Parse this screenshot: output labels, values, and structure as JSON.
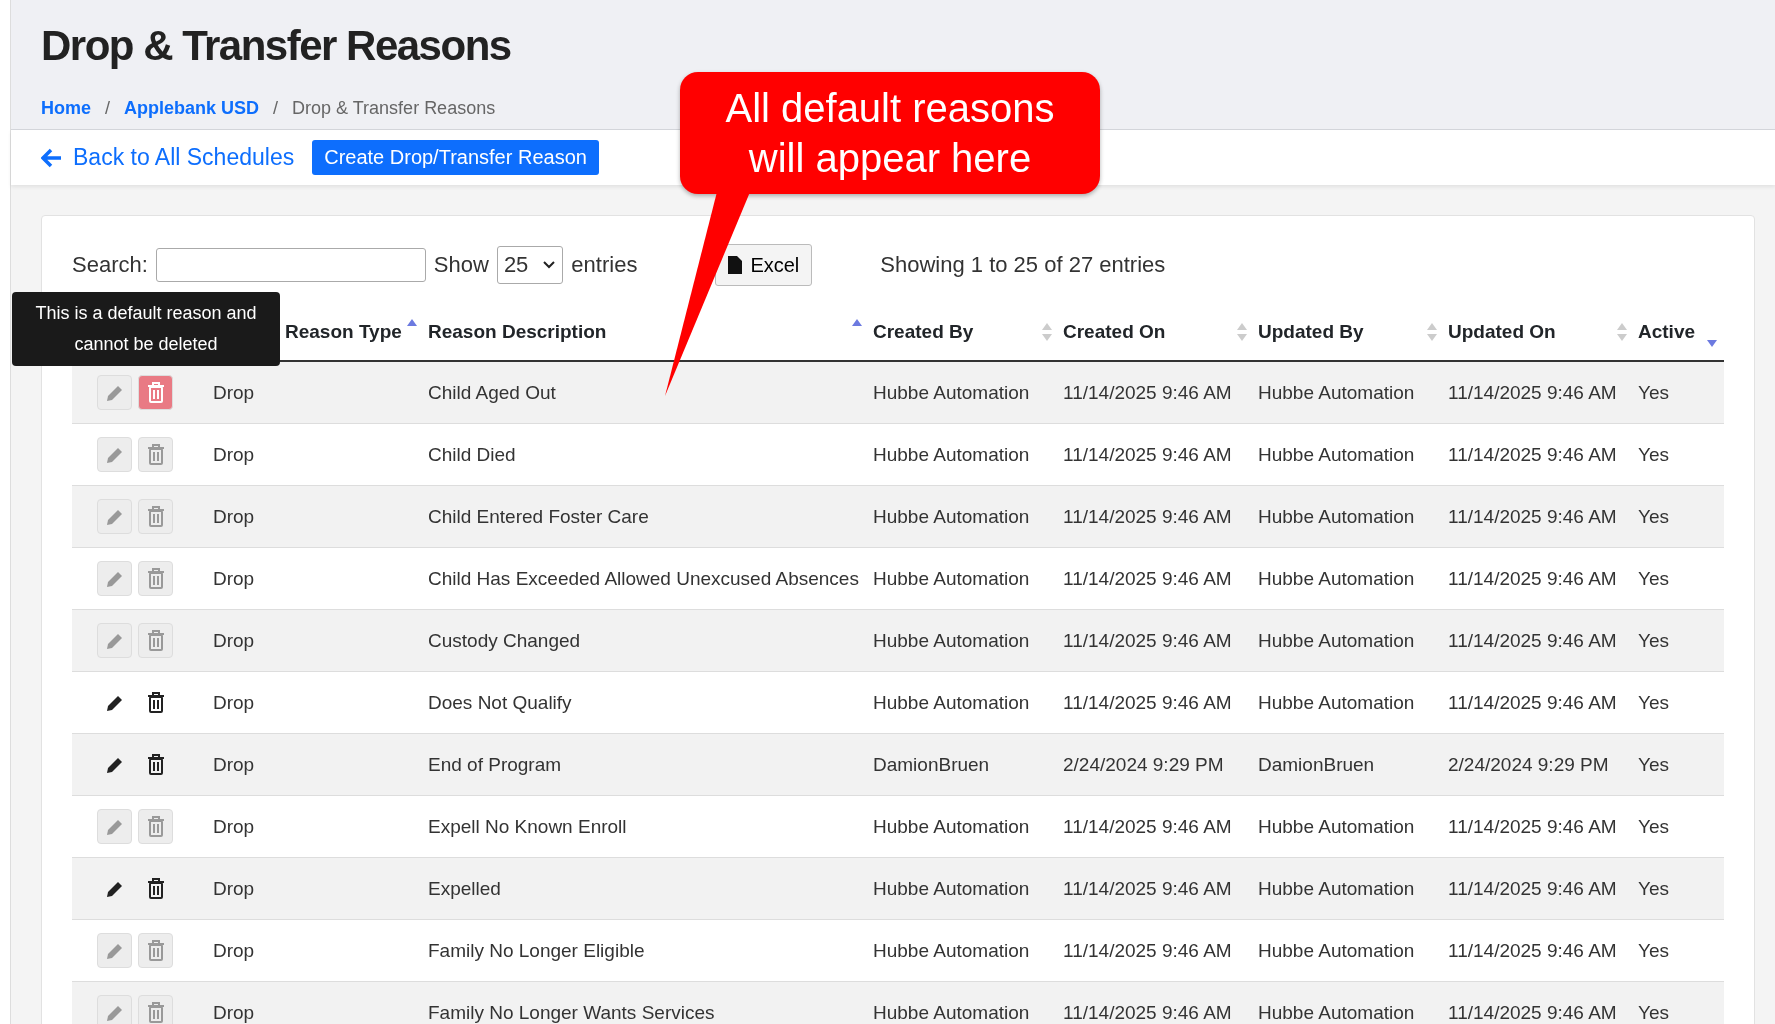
{
  "title": "Drop & Transfer Reasons",
  "breadcrumb": [
    {
      "label": "Home",
      "link": true
    },
    {
      "separator": "/",
      "label": "Applebank USD",
      "link": true
    },
    {
      "separator": "/",
      "label": "Drop & Transfer Reasons",
      "link": false
    }
  ],
  "back_link": "Back to All Schedules",
  "create_button": "Create Drop/Transfer Reason",
  "search": {
    "label": "Search:"
  },
  "page_size": {
    "label_before": "Show",
    "value": "25",
    "label_after": "entries"
  },
  "export_button": "Excel",
  "info": "Showing 1 to 25 of 27 entries",
  "tooltip": "This is a default reason and cannot be deleted",
  "callout": "All default reasons will appear here",
  "columns": [
    {
      "label": "Reason Type",
      "sorted": true,
      "descending": false
    },
    {
      "label": "Reason Description",
      "sorted": true,
      "descending": false
    },
    {
      "label": "Created By",
      "sorted": false
    },
    {
      "label": "Created On",
      "sorted": false
    },
    {
      "label": "Updated By",
      "sorted": false
    },
    {
      "label": "Updated On",
      "sorted": false
    },
    {
      "label": "Active",
      "sorted": true,
      "descending": true
    }
  ],
  "rows": [
    {
      "default": true,
      "delete_hovered": true,
      "cells": [
        "Drop",
        "Child Aged Out",
        "Hubbe Automation",
        "11/14/2025 9:46 AM",
        "Hubbe Automation",
        "11/14/2025 9:46 AM",
        "Yes"
      ]
    },
    {
      "default": true,
      "delete_hovered": false,
      "cells": [
        "Drop",
        "Child Died",
        "Hubbe Automation",
        "11/14/2025 9:46 AM",
        "Hubbe Automation",
        "11/14/2025 9:46 AM",
        "Yes"
      ]
    },
    {
      "default": true,
      "delete_hovered": false,
      "cells": [
        "Drop",
        "Child Entered Foster Care",
        "Hubbe Automation",
        "11/14/2025 9:46 AM",
        "Hubbe Automation",
        "11/14/2025 9:46 AM",
        "Yes"
      ]
    },
    {
      "default": true,
      "delete_hovered": false,
      "cells": [
        "Drop",
        "Child Has Exceeded Allowed Unexcused Absences",
        "Hubbe Automation",
        "11/14/2025 9:46 AM",
        "Hubbe Automation",
        "11/14/2025 9:46 AM",
        "Yes"
      ]
    },
    {
      "default": true,
      "delete_hovered": false,
      "cells": [
        "Drop",
        "Custody Changed",
        "Hubbe Automation",
        "11/14/2025 9:46 AM",
        "Hubbe Automation",
        "11/14/2025 9:46 AM",
        "Yes"
      ]
    },
    {
      "default": false,
      "delete_hovered": false,
      "cells": [
        "Drop",
        "Does Not Qualify",
        "Hubbe Automation",
        "11/14/2025 9:46 AM",
        "Hubbe Automation",
        "11/14/2025 9:46 AM",
        "Yes"
      ]
    },
    {
      "default": false,
      "delete_hovered": false,
      "cells": [
        "Drop",
        "End of Program",
        "DamionBruen",
        "2/24/2024 9:29 PM",
        "DamionBruen",
        "2/24/2024 9:29 PM",
        "Yes"
      ]
    },
    {
      "default": true,
      "delete_hovered": false,
      "cells": [
        "Drop",
        "Expell No Known Enroll",
        "Hubbe Automation",
        "11/14/2025 9:46 AM",
        "Hubbe Automation",
        "11/14/2025 9:46 AM",
        "Yes"
      ]
    },
    {
      "default": false,
      "delete_hovered": false,
      "cells": [
        "Drop",
        "Expelled",
        "Hubbe Automation",
        "11/14/2025 9:46 AM",
        "Hubbe Automation",
        "11/14/2025 9:46 AM",
        "Yes"
      ]
    },
    {
      "default": true,
      "delete_hovered": false,
      "cells": [
        "Drop",
        "Family No Longer Eligible",
        "Hubbe Automation",
        "11/14/2025 9:46 AM",
        "Hubbe Automation",
        "11/14/2025 9:46 AM",
        "Yes"
      ]
    },
    {
      "default": true,
      "delete_hovered": false,
      "cells": [
        "Drop",
        "Family No Longer Wants Services",
        "Hubbe Automation",
        "11/14/2025 9:46 AM",
        "Hubbe Automation",
        "11/14/2025 9:46 AM",
        "Yes"
      ]
    }
  ]
}
